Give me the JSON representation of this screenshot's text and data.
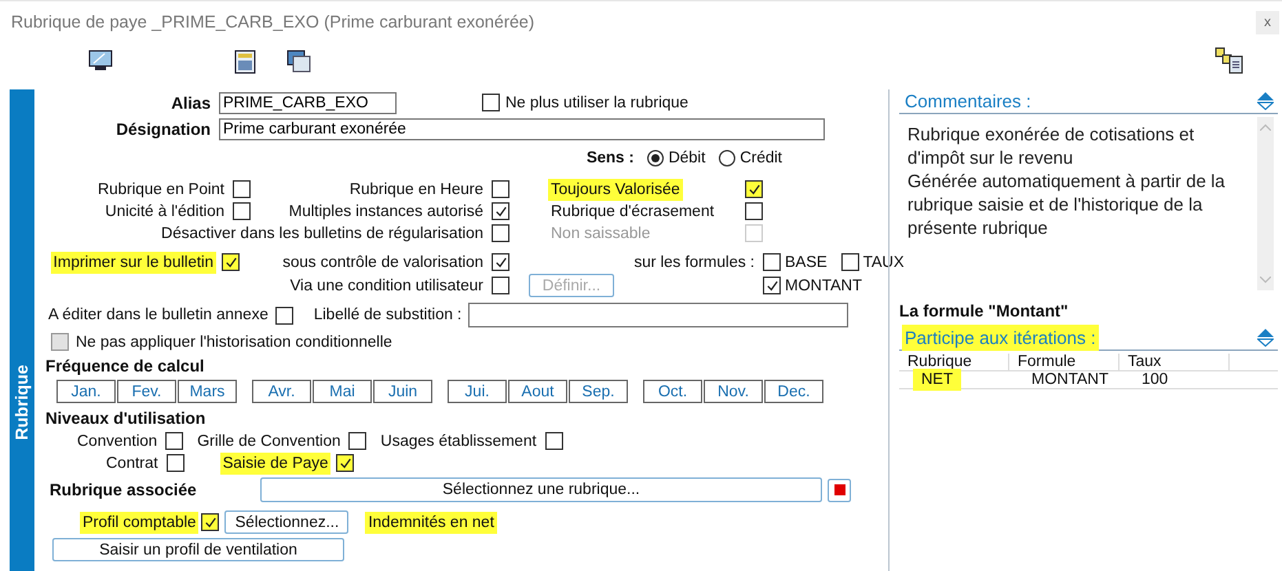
{
  "window": {
    "title": "Rubrique de paye _PRIME_CARB_EXO (Prime carburant exonérée)",
    "close": "x"
  },
  "side_tab": "Rubrique",
  "header": {
    "alias_label": "Alias",
    "alias": "PRIME_CARB_EXO",
    "designation_label": "Désignation",
    "designation": "Prime carburant exonérée",
    "retire": {
      "label": "Ne plus utiliser la rubrique",
      "checked": false
    }
  },
  "sens": {
    "label": "Sens :",
    "options": [
      {
        "label": "Débit",
        "selected": true
      },
      {
        "label": "Crédit",
        "selected": false
      }
    ]
  },
  "flag_rows": [
    [
      {
        "label": "Rubrique en Point",
        "checked": false,
        "highlighted": false,
        "disabled": false
      },
      {
        "label": "Rubrique en Heure",
        "checked": false,
        "highlighted": false,
        "disabled": false
      },
      {
        "label": "Toujours Valorisée",
        "checked": true,
        "highlighted": true,
        "disabled": false
      }
    ],
    [
      {
        "label": "Unicité à l'édition",
        "checked": false,
        "highlighted": false,
        "disabled": false
      },
      {
        "label": "Multiples instances autorisé",
        "checked": true,
        "highlighted": false,
        "disabled": false
      },
      {
        "label": "Rubrique d'écrasement",
        "checked": false,
        "highlighted": false,
        "disabled": false
      }
    ],
    [
      {
        "label": "Désactiver dans les bulletins de régularisation",
        "checked": false,
        "highlighted": false,
        "disabled": false
      },
      {
        "label": "Non saissable",
        "checked": false,
        "highlighted": false,
        "disabled": true
      }
    ]
  ],
  "printing": {
    "imprimer": {
      "label": "Imprimer sur le bulletin",
      "checked": true,
      "highlighted": true
    },
    "sous_controle": {
      "label": "sous contrôle de valorisation",
      "checked": true
    },
    "condition": {
      "label": "Via une condition utilisateur",
      "checked": false
    },
    "definir": {
      "label": "Définir...",
      "disabled": true
    },
    "formulas_label": "sur les formules :",
    "formulas": [
      {
        "label": "BASE",
        "checked": false
      },
      {
        "label": "TAUX",
        "checked": false
      },
      {
        "label": "MONTANT",
        "checked": true
      }
    ],
    "annexe": {
      "label": "A éditer dans le bulletin annexe",
      "checked": false
    },
    "substitution_label": "Libellé de substition :"
  },
  "historisation": {
    "label": "Ne pas appliquer l'historisation conditionnelle",
    "checked": false
  },
  "frequence": {
    "title": "Fréquence de calcul",
    "groups": [
      [
        "Jan.",
        "Fev.",
        "Mars"
      ],
      [
        "Avr.",
        "Mai",
        "Juin"
      ],
      [
        "Jui.",
        "Aout",
        "Sep."
      ],
      [
        "Oct.",
        "Nov.",
        "Dec."
      ]
    ]
  },
  "niveaux": {
    "title": "Niveaux d'utilisation",
    "rows": [
      [
        {
          "label": "Convention",
          "checked": false,
          "highlighted": false
        },
        {
          "label": "Grille de Convention",
          "checked": false,
          "highlighted": false
        },
        {
          "label": "Usages établissement",
          "checked": false,
          "highlighted": false
        }
      ],
      [
        {
          "label": "Contrat",
          "checked": false,
          "highlighted": false
        },
        {
          "label": "Saisie de Paye",
          "checked": true,
          "highlighted": true
        }
      ]
    ]
  },
  "associee": {
    "label": "Rubrique associée",
    "button": "Sélectionnez une rubrique..."
  },
  "profil": {
    "label": "Profil comptable",
    "checked": true,
    "highlighted": true,
    "button": "Sélectionnez...",
    "value": "Indemnités en net",
    "value_highlighted": true
  },
  "ventilation_button": "Saisir un profil de ventilation",
  "comments": {
    "title": "Commentaires :",
    "text": "Rubrique exonérée de cotisations et d'impôt sur le revenu\nGénérée automatiquement à partir de la rubrique saisie et de l'historique de la présente rubrique"
  },
  "formula": {
    "title": "La formule \"Montant\"",
    "subtitle": "Participe aux itérations :",
    "subtitle_highlighted": true,
    "columns": [
      "Rubrique",
      "Formule",
      "Taux"
    ],
    "rows": [
      {
        "cells": [
          {
            "text": "NET",
            "highlighted": true
          },
          {
            "text": "MONTANT",
            "highlighted": false
          },
          {
            "text": "100",
            "highlighted": false
          }
        ]
      }
    ]
  }
}
